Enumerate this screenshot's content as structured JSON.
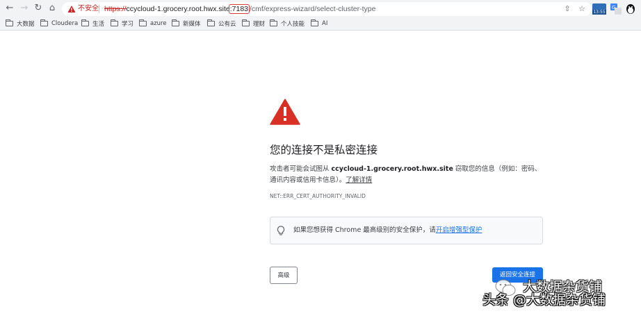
{
  "browser": {
    "url": {
      "insecure_label": "不安全",
      "scheme": "https://",
      "host": "ccycloud-1.grocery.root.hwx.site",
      "port": ":7183",
      "path": "/cmf/express-wizard/select-cluster-type"
    },
    "extension_badge": "13:55"
  },
  "bookmarks": [
    {
      "label": "大数据"
    },
    {
      "label": "Cloudera"
    },
    {
      "label": "生活"
    },
    {
      "label": "学习"
    },
    {
      "label": "azure"
    },
    {
      "label": "新媒体"
    },
    {
      "label": "公有云"
    },
    {
      "label": "理财"
    },
    {
      "label": "个人技能"
    },
    {
      "label": "AI"
    }
  ],
  "interstitial": {
    "heading": "您的连接不是私密连接",
    "body_prefix": "攻击者可能会试图从 ",
    "body_host": "ccycloud-1.grocery.root.hwx.site",
    "body_suffix": " 窃取您的信息（例如：密码、通讯内容或信用卡信息）。",
    "learn_more": "了解详情",
    "error_code": "NET::ERR_CERT_AUTHORITY_INVALID",
    "protection_prefix": "如果您想获得 Chrome 最高级别的安全保护，请",
    "protection_link": "开启增强型保护",
    "advanced_button": "高级",
    "back_button": "返回安全连接"
  },
  "watermark": {
    "top": "大数据杂货铺",
    "bottom": "头条 @大数据杂货铺"
  },
  "colors": {
    "warning_red": "#d93025",
    "primary_blue": "#1a73e8",
    "toolbar_bg": "#f1f3f4"
  }
}
